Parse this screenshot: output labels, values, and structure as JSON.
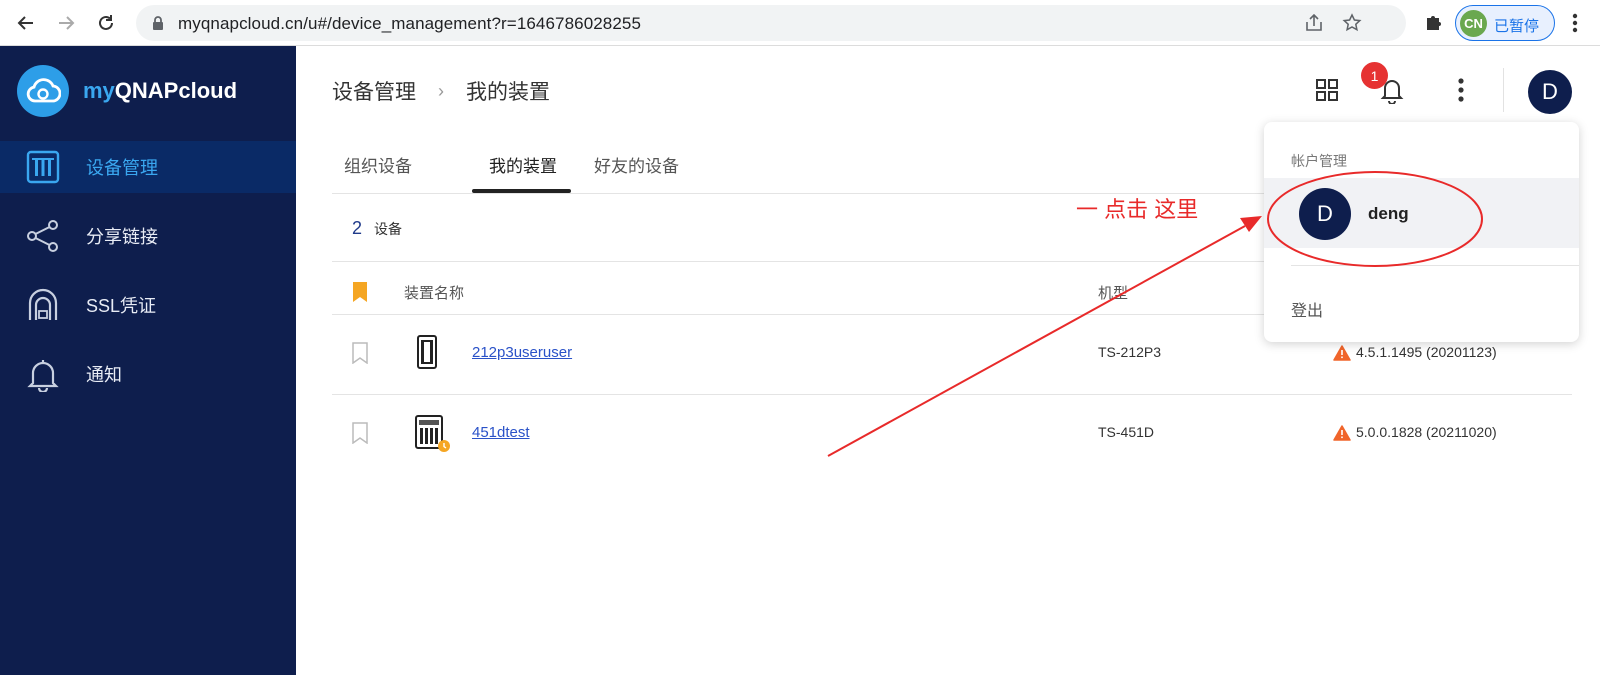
{
  "browser": {
    "url": "myqnapcloud.cn/u#/device_management?r=1646786028255",
    "profile_initials": "CN",
    "profile_status": "已暂停"
  },
  "app": {
    "brand_my": "my",
    "brand_rest": "QNAPcloud"
  },
  "sidebar": {
    "items": [
      {
        "label": "设备管理",
        "icon": "device-icon",
        "active": true
      },
      {
        "label": "分享链接",
        "icon": "share-icon",
        "active": false
      },
      {
        "label": "SSL凭证",
        "icon": "ssl-lock-icon",
        "active": false
      },
      {
        "label": "通知",
        "icon": "bell-icon",
        "active": false
      }
    ]
  },
  "header": {
    "breadcrumb": [
      "设备管理",
      "我的装置"
    ],
    "notification_count": "1",
    "avatar_initial": "D"
  },
  "tabs": [
    {
      "label": "组织设备",
      "active": false
    },
    {
      "label": "我的装置",
      "active": true
    },
    {
      "label": "好友的设备",
      "active": false
    }
  ],
  "device_count": {
    "value": "2",
    "unit": "设备"
  },
  "table": {
    "headers": {
      "name": "装置名称",
      "model": "机型"
    },
    "rows": [
      {
        "name": "212p3useruser",
        "model": "TS-212P3",
        "firmware": "4.5.1.1495 (20201123)"
      },
      {
        "name": "451dtest",
        "model": "TS-451D",
        "firmware": "5.0.0.1828 (20211020)"
      }
    ]
  },
  "account_menu": {
    "title": "帐户管理",
    "user_initial": "D",
    "username": "deng",
    "logout": "登出"
  },
  "annotation": {
    "text": "一  点击 这里"
  },
  "colors": {
    "sidebar_bg": "#0e1e4d",
    "accent": "#3aa7f0",
    "badge": "#e63232",
    "annotation": "#e82a2a",
    "warning": "#f0652b"
  }
}
